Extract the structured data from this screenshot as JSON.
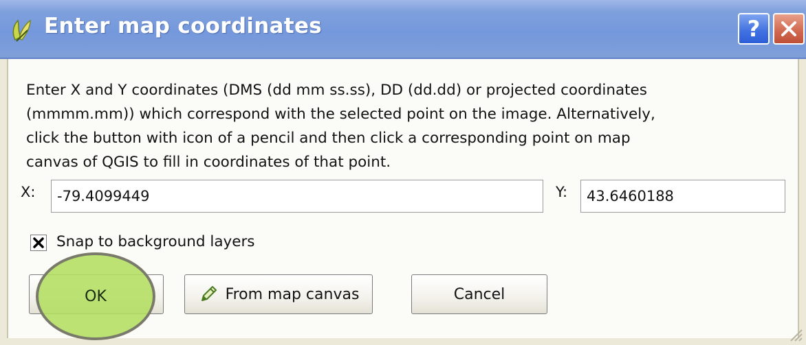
{
  "window": {
    "title": "Enter map coordinates",
    "help_label": "?"
  },
  "dialog": {
    "description": "Enter X and Y coordinates (DMS (dd mm ss.ss), DD (dd.dd) or projected coordinates\n(mmmm.mm)) which correspond with the selected point on the image. Alternatively,\nclick the button with icon of a pencil and then click a corresponding point on map\ncanvas of QGIS to fill in coordinates of that point.",
    "x_label": "X:",
    "x_value": "-79.4099449",
    "y_label": "Y:",
    "y_value": "43.6460188",
    "snap_label": "Snap to background layers",
    "snap_checked": true
  },
  "buttons": {
    "ok_label": "OK",
    "from_map_label": "From map canvas",
    "cancel_label": "Cancel"
  },
  "icons": {
    "app": "qgis-icon",
    "pencil": "pencil-icon",
    "help": "help-icon",
    "close": "close-icon"
  },
  "colors": {
    "titlebar": "#7498dc",
    "close_button": "#d0664e",
    "help_button": "#3f6fe0",
    "highlight": "#b2de60"
  }
}
